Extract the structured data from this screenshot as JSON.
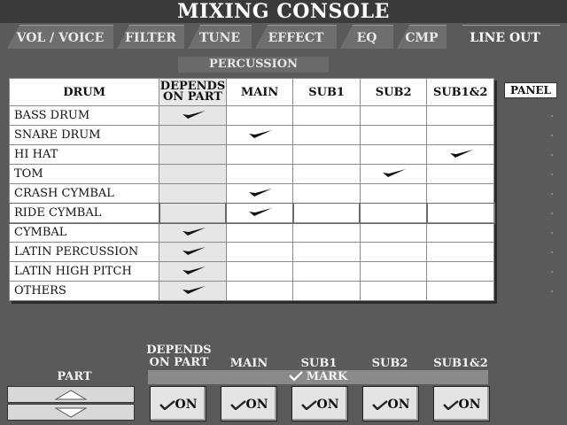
{
  "app": {
    "title": "MIXING CONSOLE"
  },
  "tabs": [
    {
      "label": "VOL / VOICE"
    },
    {
      "label": "FILTER"
    },
    {
      "label": "TUNE"
    },
    {
      "label": "EFFECT"
    },
    {
      "label": "EQ"
    },
    {
      "label": "CMP"
    },
    {
      "label": "LINE OUT",
      "active": true
    }
  ],
  "section_label": "PERCUSSION",
  "table": {
    "headers": {
      "drum": "DRUM",
      "depends_line1": "DEPENDS",
      "depends_line2": "ON PART",
      "main": "MAIN",
      "sub1": "SUB1",
      "sub2": "SUB2",
      "sub12": "SUB1&2"
    },
    "rows": [
      {
        "drum": "BASS DRUM",
        "selection": "depends"
      },
      {
        "drum": "SNARE DRUM",
        "selection": "main"
      },
      {
        "drum": "HI HAT",
        "selection": "sub12"
      },
      {
        "drum": "TOM",
        "selection": "sub2"
      },
      {
        "drum": "CRASH CYMBAL",
        "selection": "main"
      },
      {
        "drum": "RIDE CYMBAL",
        "selection": "main",
        "selected": true
      },
      {
        "drum": "CYMBAL",
        "selection": "depends"
      },
      {
        "drum": "LATIN PERCUSSION",
        "selection": "depends"
      },
      {
        "drum": "LATIN HIGH PITCH",
        "selection": "depends"
      },
      {
        "drum": "OTHERS",
        "selection": "depends"
      }
    ]
  },
  "panel_button": "PANEL",
  "bottom": {
    "part_label": "PART",
    "columns": {
      "depends_line1": "DEPENDS",
      "depends_line2": "ON PART",
      "main": "MAIN",
      "sub1": "SUB1",
      "sub2": "SUB2",
      "sub12": "SUB1&2"
    },
    "mark_label": "MARK",
    "on_label": "ON"
  },
  "colors": {
    "background": "#5a5a5a",
    "title_bar": "#3a3a3a",
    "grid": "#ffffff",
    "depends_column": "#e6e6e6"
  }
}
